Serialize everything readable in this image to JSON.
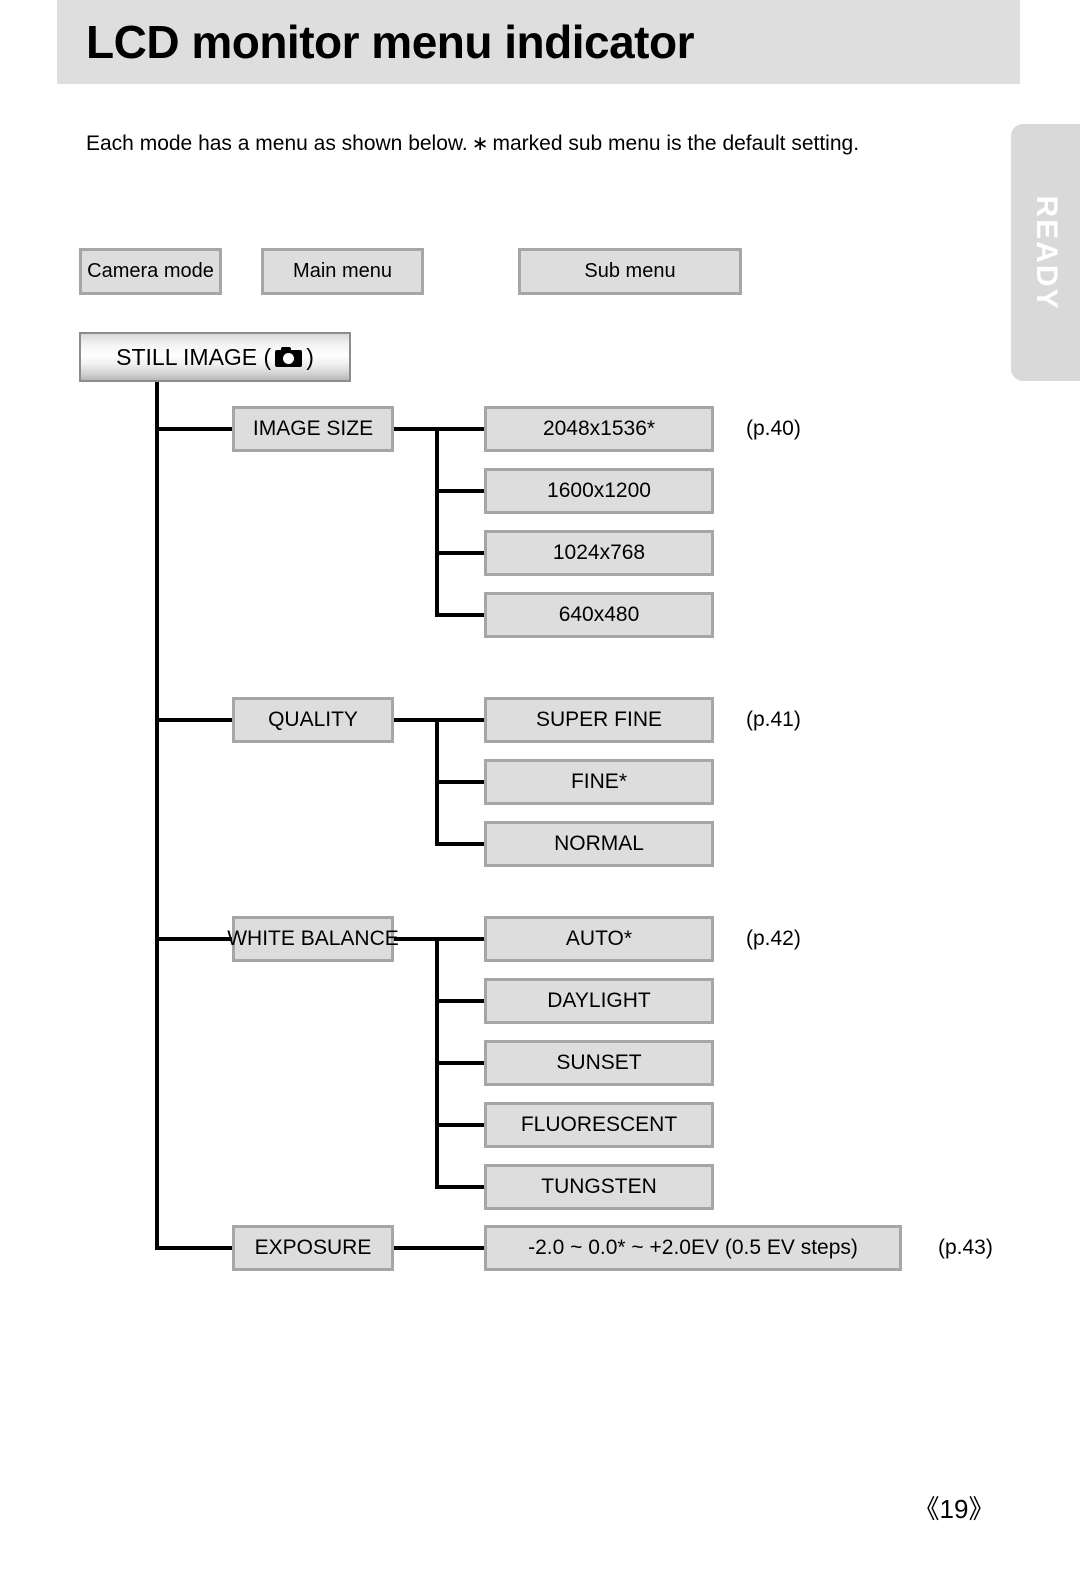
{
  "header": {
    "title": "LCD monitor menu indicator"
  },
  "side_tab": {
    "label": "READY"
  },
  "intro": {
    "part1": "Each mode has a menu as shown below.",
    "asterisk": "∗",
    "part2": "marked sub menu is the default setting."
  },
  "legend": [
    {
      "label": "Camera mode"
    },
    {
      "label": "Main menu"
    },
    {
      "label": "Sub menu"
    }
  ],
  "camera_mode": {
    "label_before": "STILL IMAGE (",
    "icon": "camera-icon",
    "label_after": ")"
  },
  "menu_tree": [
    {
      "main": "IMAGE SIZE",
      "page_ref": "(p.40)",
      "subs": [
        "2048x1536*",
        "1600x1200",
        "1024x768",
        "640x480"
      ]
    },
    {
      "main": "QUALITY",
      "page_ref": "(p.41)",
      "subs": [
        "SUPER FINE",
        "FINE*",
        "NORMAL"
      ]
    },
    {
      "main": "WHITE BALANCE",
      "page_ref": "(p.42)",
      "subs": [
        "AUTO*",
        "DAYLIGHT",
        "SUNSET",
        "FLUORESCENT",
        "TUNGSTEN"
      ]
    },
    {
      "main": "EXPOSURE",
      "page_ref": "(p.43)",
      "subs": [
        "-2.0 ~ 0.0* ~ +2.0EV (0.5 EV steps)"
      ]
    }
  ],
  "footer": {
    "page_number": "《19》"
  },
  "colors": {
    "header_band": "#dedede",
    "box_fill": "#dddddd",
    "box_border": "#a6a6a6",
    "line": "#000000",
    "side_tab": "#d9d9d9"
  }
}
